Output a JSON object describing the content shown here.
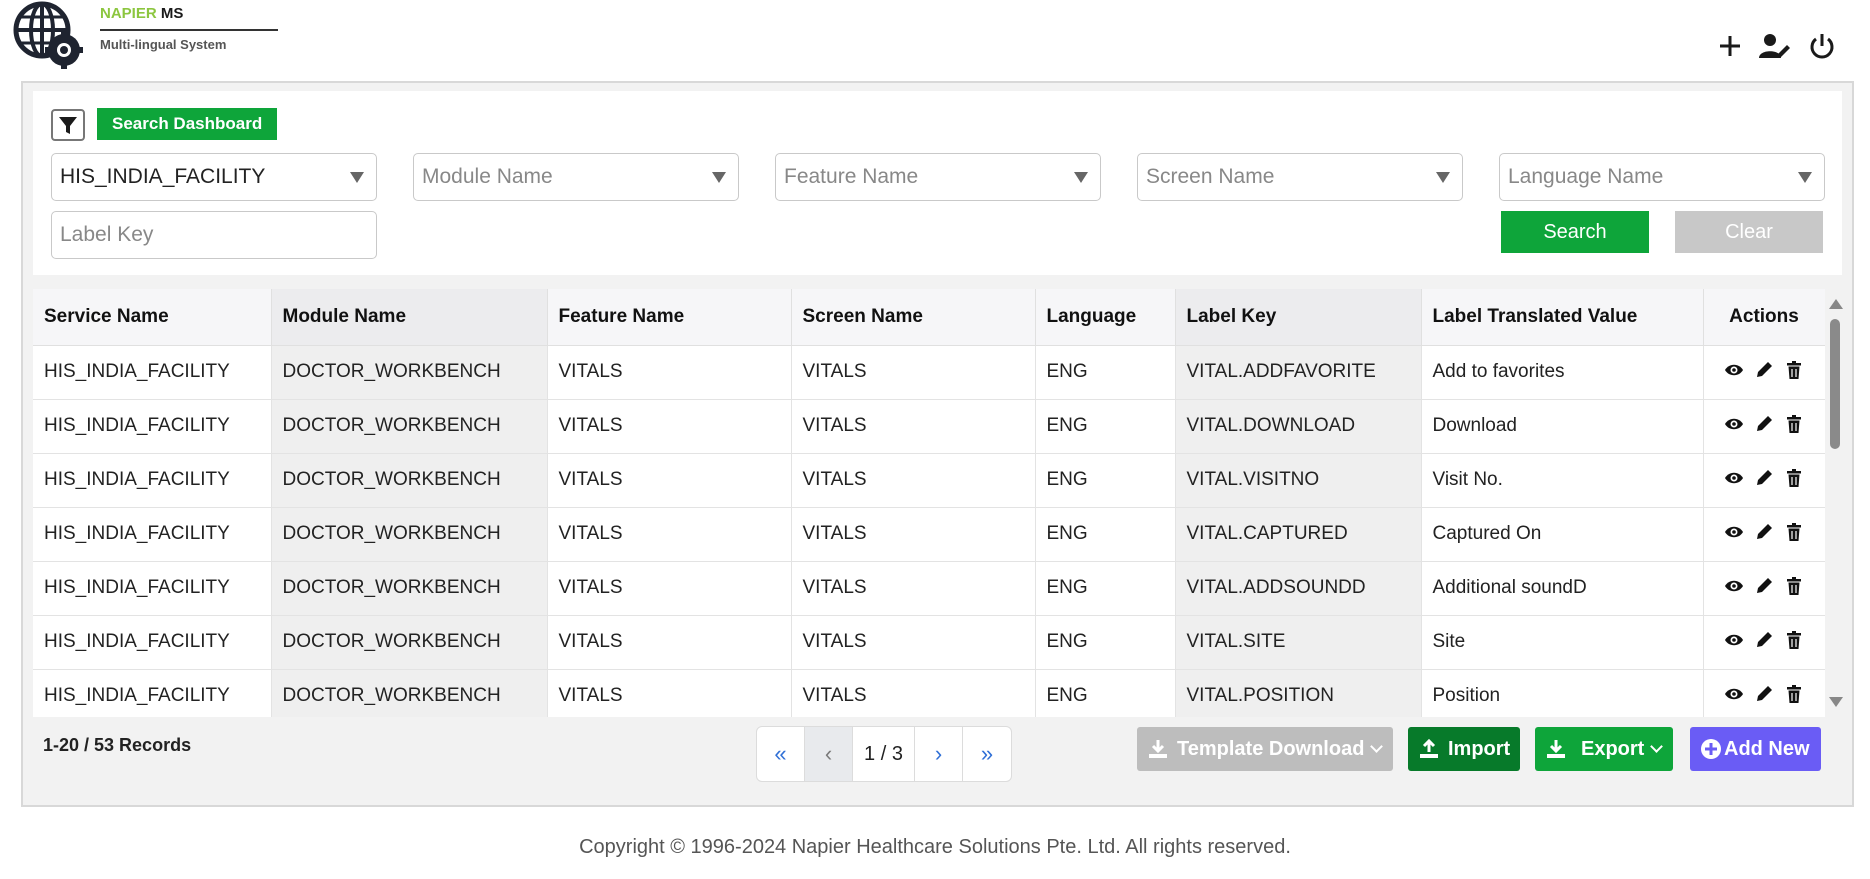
{
  "header": {
    "brand_name_part1": "NAPIER",
    "brand_name_part2": "MS",
    "subtitle": "Multi-lingual System",
    "icons": [
      "plus-icon",
      "user-edit-icon",
      "power-icon"
    ]
  },
  "filters": {
    "badge": "Search Dashboard",
    "service": "HIS_INDIA_FACILITY",
    "module_placeholder": "Module Name",
    "feature_placeholder": "Feature Name",
    "screen_placeholder": "Screen Name",
    "language_placeholder": "Language Name",
    "label_key_placeholder": "Label Key",
    "search_label": "Search",
    "clear_label": "Clear"
  },
  "table": {
    "columns": [
      "Service Name",
      "Module Name",
      "Feature Name",
      "Screen Name",
      "Language",
      "Label Key",
      "Label Translated Value",
      "Actions"
    ],
    "rows": [
      [
        "HIS_INDIA_FACILITY",
        "DOCTOR_WORKBENCH",
        "VITALS",
        "VITALS",
        "ENG",
        "VITAL.ADDFAVORITE",
        "Add to favorites"
      ],
      [
        "HIS_INDIA_FACILITY",
        "DOCTOR_WORKBENCH",
        "VITALS",
        "VITALS",
        "ENG",
        "VITAL.DOWNLOAD",
        "Download"
      ],
      [
        "HIS_INDIA_FACILITY",
        "DOCTOR_WORKBENCH",
        "VITALS",
        "VITALS",
        "ENG",
        "VITAL.VISITNO",
        "Visit No."
      ],
      [
        "HIS_INDIA_FACILITY",
        "DOCTOR_WORKBENCH",
        "VITALS",
        "VITALS",
        "ENG",
        "VITAL.CAPTURED",
        "Captured On"
      ],
      [
        "HIS_INDIA_FACILITY",
        "DOCTOR_WORKBENCH",
        "VITALS",
        "VITALS",
        "ENG",
        "VITAL.ADDSOUNDD",
        "Additional soundD"
      ],
      [
        "HIS_INDIA_FACILITY",
        "DOCTOR_WORKBENCH",
        "VITALS",
        "VITALS",
        "ENG",
        "VITAL.SITE",
        "Site"
      ],
      [
        "HIS_INDIA_FACILITY",
        "DOCTOR_WORKBENCH",
        "VITALS",
        "VITALS",
        "ENG",
        "VITAL.POSITION",
        "Position"
      ]
    ]
  },
  "footer_bar": {
    "records": "1-20 / 53 Records",
    "first": "«",
    "prev": "‹",
    "page": "1 / 3",
    "next": "›",
    "last": "»",
    "template_download": "Template Download",
    "import": "Import",
    "export": "Export",
    "add_new": "Add New"
  },
  "colors": {
    "green": "#0ea53a",
    "dark_green": "#077a2a",
    "purple": "#6a5cf5",
    "grey": "#bdbdbd",
    "brand_green": "#8cc63f"
  },
  "copyright": "Copyright © 1996-2024 Napier Healthcare Solutions Pte. Ltd. All rights reserved."
}
